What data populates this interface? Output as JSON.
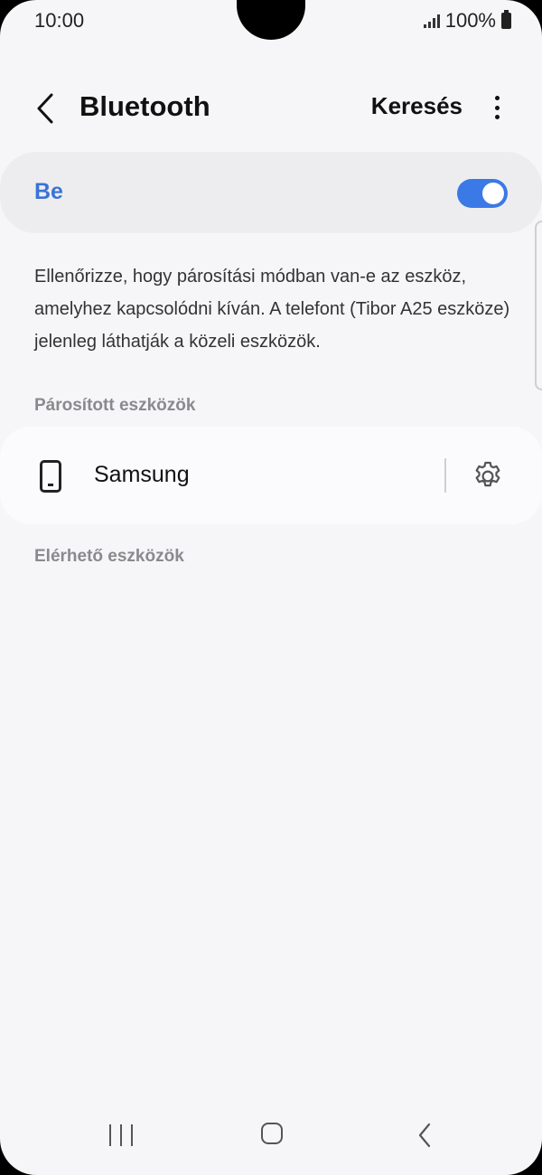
{
  "status_bar": {
    "time": "10:00",
    "battery": "100%"
  },
  "header": {
    "title": "Bluetooth",
    "search_label": "Keresés"
  },
  "toggle": {
    "label": "Be",
    "state": "on",
    "accent": "#3b79e6"
  },
  "info_text": "Ellenőrizze, hogy párosítási módban van-e az eszköz, amelyhez kapcsolódni kíván. A telefont (Tibor A25 eszköze) jelenleg láthatják a közeli eszközök.",
  "paired": {
    "section_label": "Párosított eszközök",
    "devices": [
      {
        "name": "Samsung",
        "icon": "phone-icon",
        "action_icon": "gear-icon"
      }
    ]
  },
  "available": {
    "section_label": "Elérhető eszközök"
  }
}
